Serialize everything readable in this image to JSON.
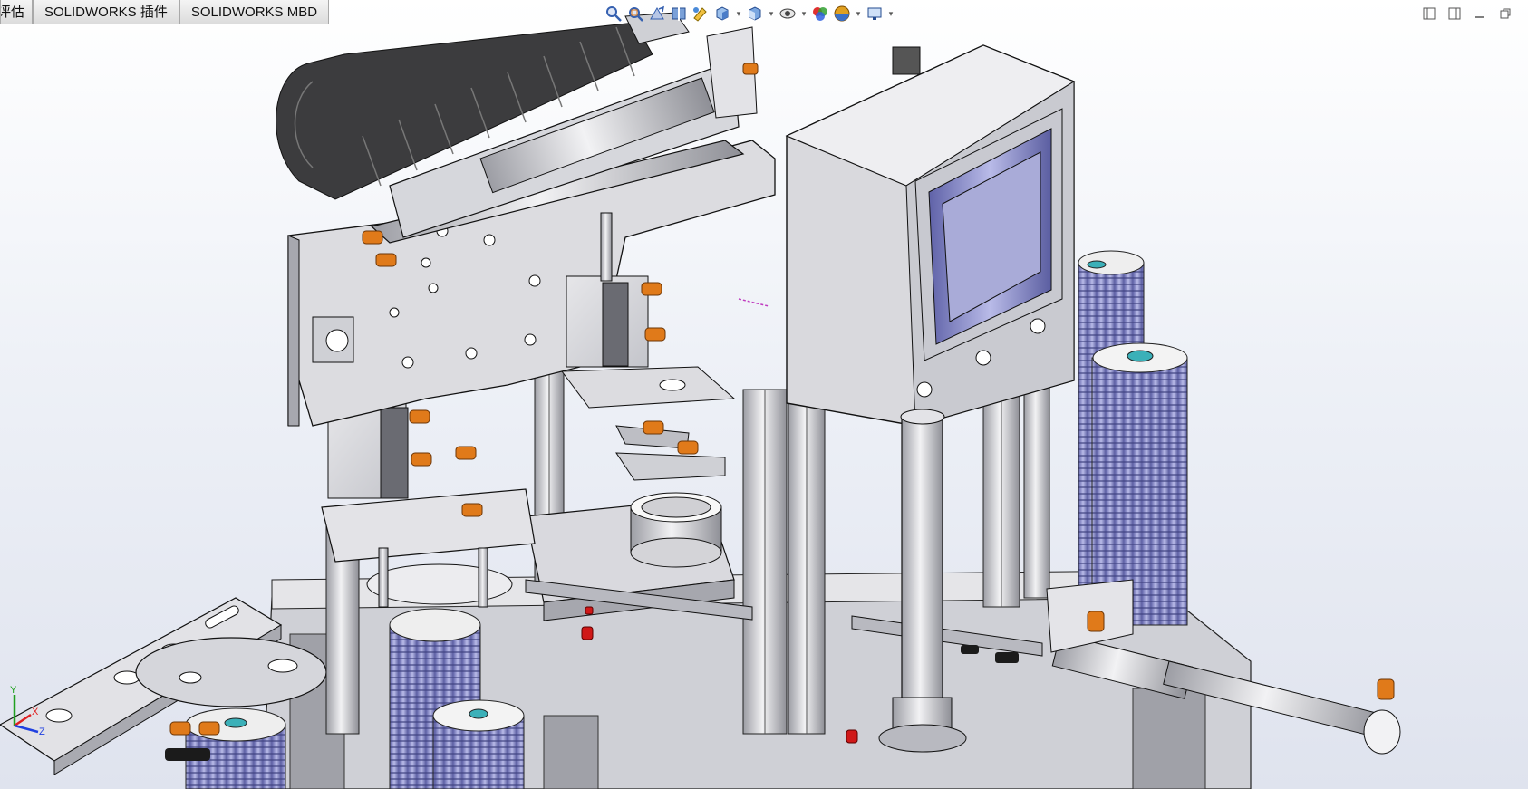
{
  "tabs": [
    {
      "label": "评估"
    },
    {
      "label": "SOLIDWORKS 插件"
    },
    {
      "label": "SOLIDWORKS MBD"
    }
  ],
  "hud_toolbar": [
    {
      "name": "zoom-to-fit-icon"
    },
    {
      "name": "zoom-to-area-icon"
    },
    {
      "name": "previous-view-icon"
    },
    {
      "name": "section-view-icon"
    },
    {
      "name": "dynamic-annotation-icon"
    },
    {
      "name": "view-orientation-icon"
    },
    {
      "name": "display-style-icon"
    },
    {
      "name": "hide-show-items-icon"
    },
    {
      "name": "edit-appearance-icon"
    },
    {
      "name": "apply-scene-icon"
    },
    {
      "name": "view-settings-icon"
    }
  ],
  "triad": {
    "x_label": "X",
    "y_label": "Y",
    "z_label": "Z",
    "x_color": "#e02020",
    "y_color": "#20a020",
    "z_color": "#2040e0"
  },
  "colors": {
    "frame": "#d2d3d8",
    "frame_dark": "#9a9ba2",
    "fitting_orange": "#e07a1a",
    "spring_blue": "#8c8fd0",
    "cable_chain": "#3c3c3e",
    "screen": "#a9abd8",
    "red_part": "#d01818"
  }
}
